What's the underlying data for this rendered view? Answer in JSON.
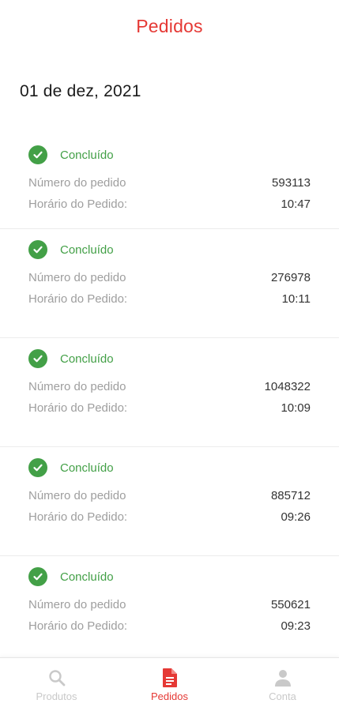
{
  "header": {
    "title": "Pedidos"
  },
  "date_heading": "01 de dez, 2021",
  "labels": {
    "order_number": "Número do pedido",
    "order_time": "Horário do Pedido:"
  },
  "orders": [
    {
      "status": "Concluído",
      "number": "593113",
      "time": "10:47"
    },
    {
      "status": "Concluído",
      "number": "276978",
      "time": "10:11"
    },
    {
      "status": "Concluído",
      "number": "1048322",
      "time": "10:09"
    },
    {
      "status": "Concluído",
      "number": "885712",
      "time": "09:26"
    },
    {
      "status": "Concluído",
      "number": "550621",
      "time": "09:23"
    }
  ],
  "nav": {
    "items": [
      {
        "label": "Produtos",
        "icon": "search-icon",
        "active": false
      },
      {
        "label": "Pedidos",
        "icon": "document-icon",
        "active": true
      },
      {
        "label": "Conta",
        "icon": "person-icon",
        "active": false
      }
    ]
  },
  "colors": {
    "accent": "#e53935",
    "success": "#43a047",
    "muted": "#9e9e9e",
    "inactive": "#c9c9c9"
  }
}
